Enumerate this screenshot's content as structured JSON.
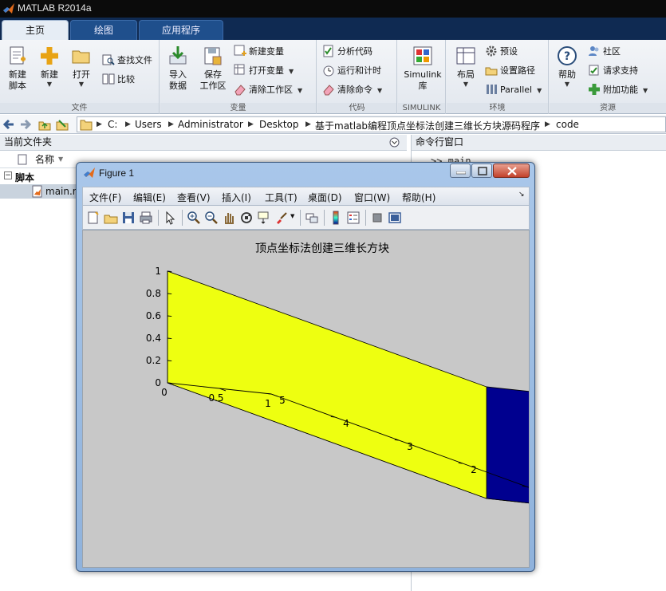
{
  "app": {
    "title": "MATLAB R2014a"
  },
  "tabs": [
    {
      "label": "主页",
      "active": true
    },
    {
      "label": "绘图",
      "active": false
    },
    {
      "label": "应用程序",
      "active": false
    }
  ],
  "ribbon": {
    "file": {
      "group_label": "文件",
      "new_script": "新建\n脚本",
      "new": "新建",
      "open": "打开",
      "find_files": "查找文件",
      "compare": "比较"
    },
    "variable": {
      "group_label": "变量",
      "import_data": "导入\n数据",
      "save_workspace": "保存\n工作区",
      "new_variable": "新建变量",
      "open_variable": "打开变量",
      "clear_workspace": "清除工作区"
    },
    "code": {
      "group_label": "代码",
      "analyze_code": "分析代码",
      "run_and_time": "运行和计时",
      "clear_commands": "清除命令"
    },
    "simulink": {
      "group_label": "SIMULINK",
      "library": "Simulink\n库"
    },
    "environment": {
      "group_label": "环境",
      "layout": "布局",
      "preferences": "预设",
      "set_path": "设置路径",
      "parallel": "Parallel"
    },
    "resources": {
      "group_label": "资源",
      "help": "帮助",
      "community": "社区",
      "request_support": "请求支持",
      "add_ons": "附加功能"
    }
  },
  "address": {
    "crumbs": [
      "C:",
      "Users",
      "Administrator",
      "Desktop",
      "基于matlab编程顶点坐标法创建三维长方块源码程序",
      "code"
    ]
  },
  "current_folder": {
    "title": "当前文件夹",
    "column_name": "名称",
    "group": "脚本",
    "file": "main.m"
  },
  "command_window": {
    "title": "命令行窗口",
    "line": ">> main"
  },
  "figure": {
    "title": "Figure 1",
    "menu": [
      "文件(F)",
      "编辑(E)",
      "查看(V)",
      "插入(I)",
      "工具(T)",
      "桌面(D)",
      "窗口(W)",
      "帮助(H)"
    ],
    "axes_title": "顶点坐标法创建三维长方块",
    "z_ticks": [
      "0",
      "0.2",
      "0.4",
      "0.6",
      "0.8",
      "1"
    ],
    "x_ticks": [
      "0",
      "0.5",
      "1"
    ],
    "y_ticks": [
      "0",
      "1",
      "2",
      "3",
      "4",
      "5"
    ],
    "face_colors": {
      "left": "#eeff10",
      "back": "#00008f",
      "bottom": "#ff3c00"
    }
  },
  "chart_data": {
    "type": "surface",
    "title": "顶点坐标法创建三维长方块",
    "box": {
      "x": [
        0,
        1
      ],
      "y": [
        0,
        5
      ],
      "z": [
        0,
        1
      ]
    },
    "faces": [
      {
        "name": "x=0",
        "color": "#eeff10"
      },
      {
        "name": "y=0",
        "color": "#00008f"
      },
      {
        "name": "z=0",
        "color": "#ff3c00"
      }
    ],
    "xlim": [
      0,
      1
    ],
    "ylim": [
      0,
      5
    ],
    "zlim": [
      0,
      1
    ]
  }
}
